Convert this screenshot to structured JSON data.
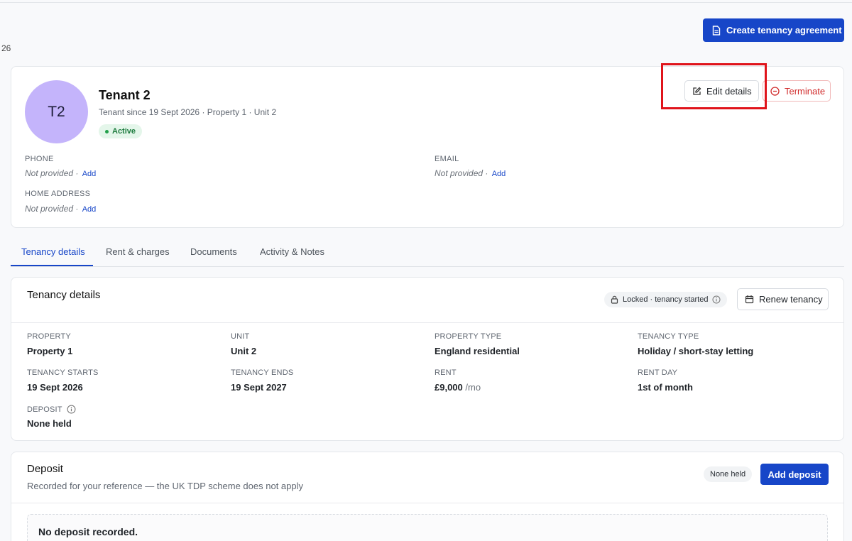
{
  "header": {
    "create_button": "Create tenancy agreement",
    "page_number": "26"
  },
  "tenant": {
    "initials": "T2",
    "name": "Tenant 2",
    "subtitle": "Tenant since 19 Sept 2026 · Property 1 · Unit 2",
    "status": "Active",
    "edit_button": "Edit details",
    "terminate_button": "Terminate",
    "contact": {
      "phone_label": "PHONE",
      "phone_value": "Not provided ·",
      "email_label": "EMAIL",
      "email_value": "Not provided ·",
      "address_label": "HOME ADDRESS",
      "address_value": "Not provided ·",
      "add_link": "Add"
    }
  },
  "tabs": [
    {
      "label": "Tenancy details",
      "active": true
    },
    {
      "label": "Rent & charges",
      "active": false
    },
    {
      "label": "Documents",
      "active": false
    },
    {
      "label": "Activity & Notes",
      "active": false
    }
  ],
  "tenancy_details": {
    "title": "Tenancy details",
    "locked_badge": "Locked · tenancy started",
    "renew_button": "Renew tenancy",
    "fields": {
      "property": {
        "label": "PROPERTY",
        "value": "Property 1"
      },
      "unit": {
        "label": "UNIT",
        "value": "Unit 2"
      },
      "property_type": {
        "label": "PROPERTY TYPE",
        "value": "England residential"
      },
      "tenancy_type": {
        "label": "TENANCY TYPE",
        "value": "Holiday / short-stay letting"
      },
      "tenancy_starts": {
        "label": "TENANCY STARTS",
        "value": "19 Sept 2026"
      },
      "tenancy_ends": {
        "label": "TENANCY ENDS",
        "value": "19 Sept 2027"
      },
      "rent": {
        "label": "RENT",
        "value": "£9,000",
        "unit": "/mo"
      },
      "rent_day": {
        "label": "RENT DAY",
        "value": "1st of month"
      },
      "deposit": {
        "label": "DEPOSIT",
        "value": "None held"
      }
    }
  },
  "deposit": {
    "title": "Deposit",
    "subtitle": "Recorded for your reference — the UK TDP scheme does not apply",
    "status_badge": "None held",
    "add_button": "Add deposit",
    "empty_message": "No deposit recorded."
  },
  "colors": {
    "primary": "#1746c8",
    "danger": "#d12c2c",
    "success": "#1b7a3c",
    "avatar": "#c4b4fb",
    "highlight": "#e0141b"
  }
}
